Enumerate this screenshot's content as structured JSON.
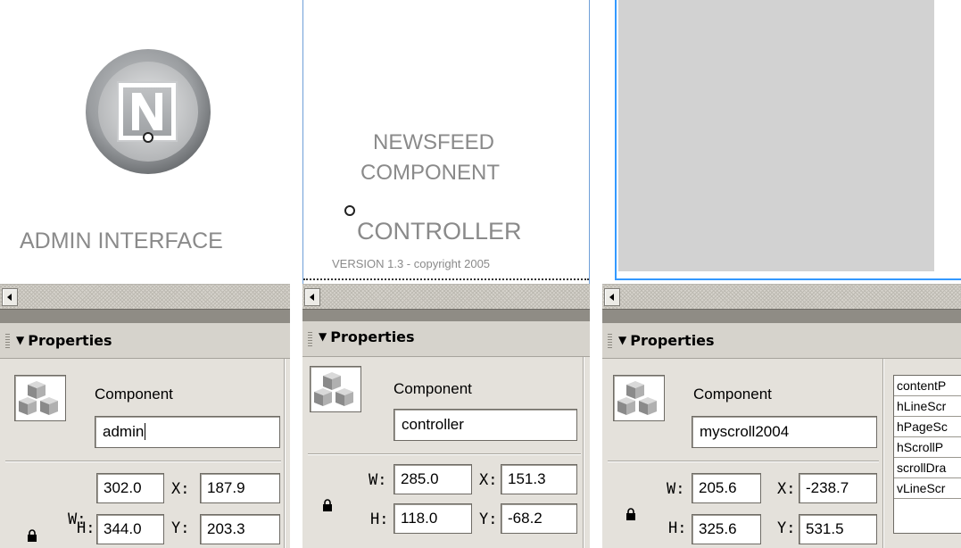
{
  "panels": [
    {
      "stage": {
        "title": "ADMIN INTERFACE"
      },
      "properties": {
        "header": "Properties",
        "component_label": "Component",
        "instance_name": "admin",
        "w_label": "W:",
        "w": "302.0",
        "x_label": "X:",
        "x": "187.9",
        "h_label": "H:",
        "h": "344.0",
        "y_label": "Y:",
        "y": "203.3"
      }
    },
    {
      "stage": {
        "line1": "NEWSFEED",
        "line2": "COMPONENT",
        "line3": "CONTROLLER",
        "version": "VERSION 1.3  -  copyright 2005"
      },
      "properties": {
        "header": "Properties",
        "component_label": "Component",
        "instance_name": "controller",
        "w_label": "W:",
        "w": "285.0",
        "x_label": "X:",
        "x": "151.3",
        "h_label": "H:",
        "h": "118.0",
        "y_label": "Y:",
        "y": "-68.2"
      }
    },
    {
      "properties": {
        "header": "Properties",
        "component_label": "Component",
        "instance_name": "myscroll2004",
        "w_label": "W:",
        "w": "205.6",
        "x_label": "X:",
        "x": "-238.7",
        "h_label": "H:",
        "h": "325.6",
        "y_label": "Y:",
        "y": "531.5",
        "parameters": [
          "contentP",
          "hLineScr",
          "hPageSc",
          "hScrollP",
          "scrollDra",
          "vLineScr"
        ]
      }
    }
  ],
  "colors": {
    "stage_text": "#8a8a8a",
    "panel_bg": "#d6d3cc",
    "selection": "#3399ff",
    "scroll_pane_fill": "#d2d2d2"
  },
  "icons": [
    "logo-n-icon",
    "component-cubes-icon",
    "lock-icon",
    "scroll-left-arrow-icon",
    "collapse-triangle-icon"
  ]
}
